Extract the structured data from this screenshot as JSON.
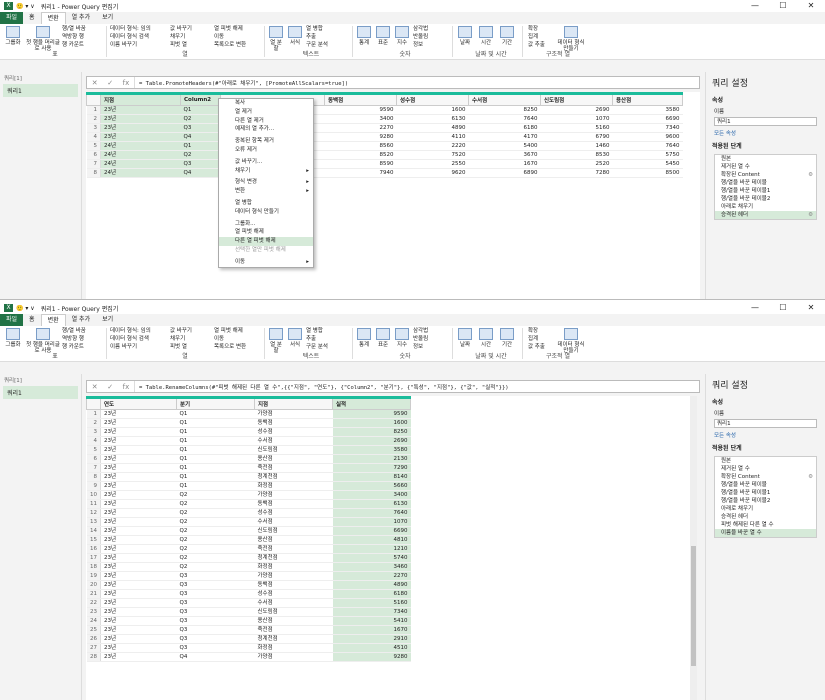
{
  "app": {
    "logo": "X",
    "qat": "🙂 ▾  ∨",
    "title": "쿼리1 - Power Query 편집기",
    "win_controls": [
      "—",
      "☐",
      "✕"
    ]
  },
  "menu_tabs": [
    "파일",
    "홈",
    "변환",
    "열 추가",
    "보기"
  ],
  "ribbon": {
    "grouping": "그룹화",
    "header_row": "첫 행을 머리글로 사용",
    "swap": "행/열 바꿈",
    "reverse": "역방향 행",
    "count": "행 카운트",
    "dtype": "데이터 형식: 임의",
    "detect": "데이터 형식 검색",
    "rename": "이름 바꾸기",
    "replace": "값 바꾸기",
    "fill": "채우기",
    "pivot": "피벗 열",
    "unpivot": "열 피벗 해제",
    "move": "이동",
    "tolist": "목록으로 변환",
    "split": "열 분할",
    "format": "서식",
    "merge": "열 병합",
    "extract": "추출",
    "parse": "구문 분석",
    "stats": "통계",
    "standard": "표준",
    "sci": "지수",
    "trig": "삼각법",
    "round": "반올림",
    "info": "정보",
    "date": "날짜",
    "time": "시간",
    "dur": "기간",
    "expand": "확장",
    "agg": "집계",
    "extractval": "값 추출",
    "struct": "데이터 형식 만들기",
    "g_table": "표",
    "g_any": "열",
    "g_text": "텍스트",
    "g_num": "숫자",
    "g_dt": "날짜 및 시간",
    "g_struct": "구조적 열"
  },
  "left": {
    "header": "쿼리[1]",
    "query": "쿼리1"
  },
  "top": {
    "formula": "= Table.PromoteHeaders(#\"아래로 채우기\", [PromoteAllScalars=true])",
    "columns": [
      "지점",
      "Column2",
      "",
      "동백점",
      "성수점",
      "수서점",
      "신도림점",
      "용산점"
    ],
    "rows": [
      [
        "23년",
        "Q1",
        "",
        "9590",
        "1600",
        "8250",
        "2690",
        "3580"
      ],
      [
        "23년",
        "Q2",
        "",
        "3400",
        "6130",
        "7640",
        "1070",
        "6690"
      ],
      [
        "23년",
        "Q3",
        "",
        "2270",
        "4890",
        "6180",
        "5160",
        "7340"
      ],
      [
        "23년",
        "Q4",
        "",
        "9280",
        "4110",
        "4170",
        "6790",
        "9600"
      ],
      [
        "24년",
        "Q1",
        "",
        "8560",
        "2220",
        "5400",
        "1460",
        "7640"
      ],
      [
        "24년",
        "Q2",
        "",
        "8520",
        "7520",
        "3670",
        "8530",
        "5750"
      ],
      [
        "24년",
        "Q3",
        "",
        "8590",
        "2550",
        "1670",
        "2520",
        "5450"
      ],
      [
        "24년",
        "Q4",
        "",
        "7940",
        "9620",
        "6890",
        "7280",
        "8500"
      ]
    ],
    "context_menu": [
      "복사",
      "열 제거",
      "다른 열 제거",
      "예제의 열 추가...",
      "",
      "중복된 항목 제거",
      "오류 제거",
      "",
      "값 바꾸기...",
      "채우기",
      "",
      "형식 변경",
      "변환",
      "",
      "열 병합",
      "데이터 형식 만들기",
      "",
      "그룹화...",
      "열 피벗 해제",
      "다른 열 피벗 해제",
      "선택한 열만 피벗 해제",
      "",
      "이동"
    ]
  },
  "bottom": {
    "formula": "= Table.RenameColumns(#\"피벗 해제된 다른 열 수\",{{\"지점\", \"연도\"}, {\"Column2\", \"분기\"}, {\"특성\", \"지점\"}, {\"값\", \"실적\"}})",
    "columns": [
      "연도",
      "분기",
      "지점",
      "실적"
    ],
    "rows": [
      [
        "23년",
        "Q1",
        "가양점",
        "9590"
      ],
      [
        "23년",
        "Q1",
        "동백점",
        "1600"
      ],
      [
        "23년",
        "Q1",
        "성수점",
        "8250"
      ],
      [
        "23년",
        "Q1",
        "수서점",
        "2690"
      ],
      [
        "23년",
        "Q1",
        "신도림점",
        "3580"
      ],
      [
        "23년",
        "Q1",
        "용산점",
        "2130"
      ],
      [
        "23년",
        "Q1",
        "죽전점",
        "7290"
      ],
      [
        "23년",
        "Q1",
        "청계천점",
        "8140"
      ],
      [
        "23년",
        "Q1",
        "화정점",
        "5660"
      ],
      [
        "23년",
        "Q2",
        "가양점",
        "3400"
      ],
      [
        "23년",
        "Q2",
        "동백점",
        "6130"
      ],
      [
        "23년",
        "Q2",
        "성수점",
        "7640"
      ],
      [
        "23년",
        "Q2",
        "수서점",
        "1070"
      ],
      [
        "23년",
        "Q2",
        "신도림점",
        "6690"
      ],
      [
        "23년",
        "Q2",
        "용산점",
        "4810"
      ],
      [
        "23년",
        "Q2",
        "죽전점",
        "1210"
      ],
      [
        "23년",
        "Q2",
        "청계천점",
        "5740"
      ],
      [
        "23년",
        "Q2",
        "화정점",
        "3460"
      ],
      [
        "23년",
        "Q3",
        "가양점",
        "2270"
      ],
      [
        "23년",
        "Q3",
        "동백점",
        "4890"
      ],
      [
        "23년",
        "Q3",
        "성수점",
        "6180"
      ],
      [
        "23년",
        "Q3",
        "수서점",
        "5160"
      ],
      [
        "23년",
        "Q3",
        "신도림점",
        "7340"
      ],
      [
        "23년",
        "Q3",
        "용산점",
        "5410"
      ],
      [
        "23년",
        "Q3",
        "죽전점",
        "1670"
      ],
      [
        "23년",
        "Q3",
        "청계천점",
        "2910"
      ],
      [
        "23년",
        "Q3",
        "화정점",
        "4510"
      ],
      [
        "23년",
        "Q4",
        "가양점",
        "9280"
      ]
    ]
  },
  "settings": {
    "title": "쿼리 설정",
    "props": "속성",
    "name_label": "이름",
    "name_value": "쿼리1",
    "all_props": "모든 속성",
    "applied": "적용된 단계",
    "steps_top": [
      "원본",
      "제거된 열 수",
      "확장된 Content",
      "행/열을 바꾼 테이블",
      "행/열을 바꾼 테이블1",
      "행/열을 바꾼 테이블2",
      "아래로 채우기",
      "승격된 헤더"
    ],
    "steps_bottom": [
      "원본",
      "제거된 열 수",
      "확장된 Content",
      "행/열을 바꾼 테이블",
      "행/열을 바꾼 테이블1",
      "행/열을 바꾼 테이블2",
      "아래로 채우기",
      "승격된 헤더",
      "피벗 해제된 다른 열 수",
      "이름을 바꾼 열 수"
    ]
  }
}
